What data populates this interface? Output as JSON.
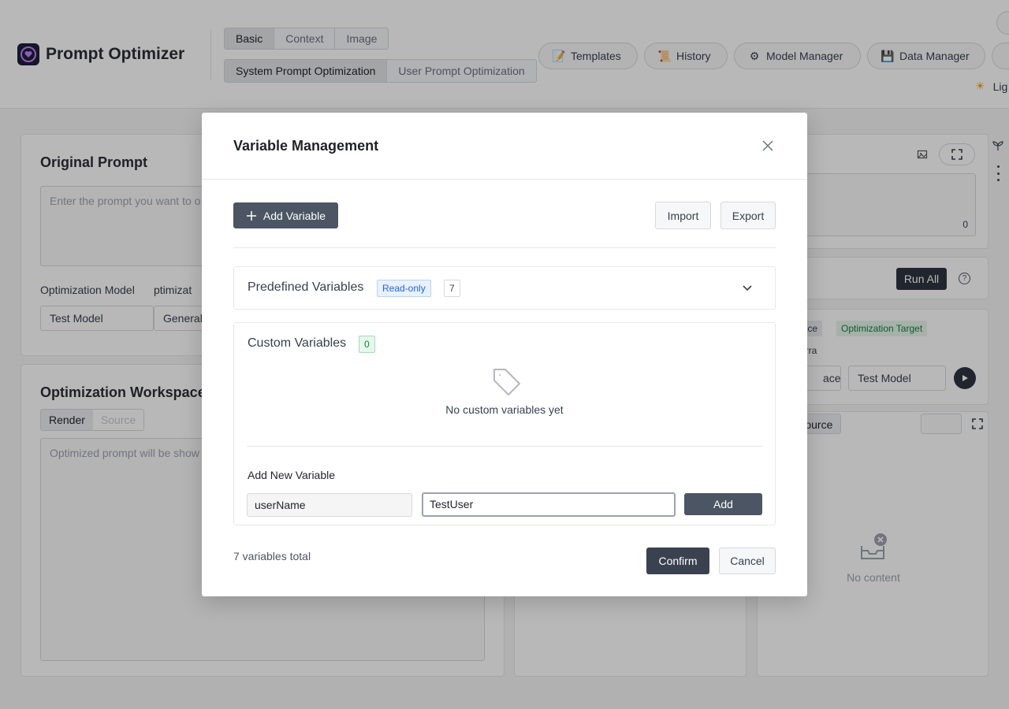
{
  "app": {
    "title": "Prompt Optimizer"
  },
  "header": {
    "mode_tabs": [
      {
        "label": "Basic",
        "active": true
      },
      {
        "label": "Context",
        "active": false
      },
      {
        "label": "Image",
        "active": false
      }
    ],
    "optimization_tabs": [
      {
        "label": "System Prompt Optimization",
        "active": true
      },
      {
        "label": "User Prompt Optimization",
        "active": false
      }
    ],
    "nav": {
      "templates": "Templates",
      "history": "History",
      "model_manager": "Model Manager",
      "data_manager": "Data Manager"
    },
    "theme_label": "Lig"
  },
  "left_panel": {
    "title": "Original Prompt",
    "placeholder": "Enter the prompt you want to o",
    "optimization_model_label": "Optimization Model",
    "optimization_template_label_fragment": "ptimizat",
    "model_value": "Test Model",
    "template_value": "General"
  },
  "workspace_panel": {
    "title": "Optimization Workspace",
    "render_tab": "Render",
    "source_tab": "Source",
    "placeholder": "Optimized prompt will be show"
  },
  "right_panel": {
    "char_count": "0",
    "run_all": "Run All",
    "tag_workspace_fragment": "pace",
    "tag_optimization_target": "Optimization Target",
    "tag_erra_fragment": "erra",
    "select_fragment": "ace",
    "test_model": "Test Model",
    "source_tab": "Source",
    "empty_text": "No content"
  },
  "modal": {
    "title": "Variable Management",
    "add_variable": "Add Variable",
    "import": "Import",
    "export": "Export",
    "predefined": {
      "title": "Predefined Variables",
      "badge": "Read-only",
      "count": "7"
    },
    "custom": {
      "title": "Custom Variables",
      "count": "0",
      "empty_text": "No custom variables yet"
    },
    "add_new": {
      "title": "Add New Variable",
      "name_value": "userName",
      "value_value": "TestUser",
      "add_button": "Add"
    },
    "footer_text": "7 variables total",
    "confirm": "Confirm",
    "cancel": "Cancel"
  },
  "colors": {
    "primary_dark": "#4b5563",
    "accent_green": "#15803d",
    "accent_blue": "#2563eb"
  }
}
